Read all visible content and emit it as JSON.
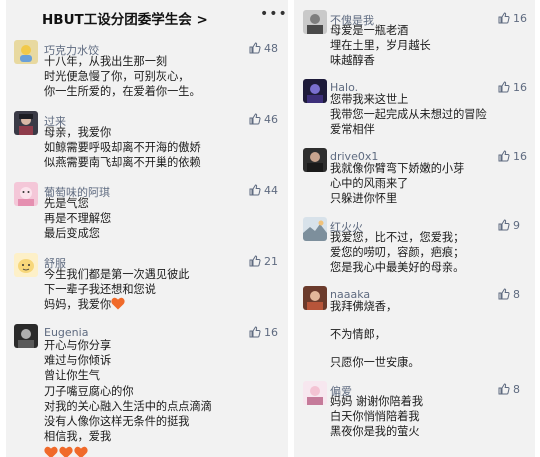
{
  "header": {
    "title": "HBUT工设分团委学生会 >"
  },
  "left": [
    {
      "nick": "巧克力水饺",
      "likes": "48",
      "lines": [
        "十八年，从我出生那一刻",
        "时光便急慢了你，可别灰心，",
        "你一生所爱的，在爱着你一生。"
      ]
    },
    {
      "nick": "过来",
      "likes": "46",
      "lines": [
        "母亲，我爱你",
        "如鲸需要呼吸却离不开海的傲娇",
        "似燕需要南飞却离不开巢的依赖"
      ]
    },
    {
      "nick": "葡萄味的阿琪",
      "likes": "44",
      "lines": [
        "先是气您",
        "再是不理解您",
        "最后变成您"
      ]
    },
    {
      "nick": "舒服",
      "likes": "21",
      "lines": [
        "今生我们都是第一次遇见彼此",
        "下一辈子我还想和您说",
        "妈妈，我爱你"
      ]
    },
    {
      "nick": "Eugenia",
      "likes": "16",
      "lines": [
        "开心与你分享",
        "难过与你倾诉",
        "曾让你生气",
        "刀子嘴豆腐心的你",
        "对我的关心融入生活中的点点滴滴",
        "没有人像你这样无条件的挺我",
        "相信我，爱我"
      ]
    }
  ],
  "right": [
    {
      "nick": "不傀是我",
      "likes": "16",
      "lines": [
        "母爱是一瓶老酒",
        "埋在土里，岁月越长",
        "味越醇香"
      ]
    },
    {
      "nick": "Halo.",
      "likes": "16",
      "lines": [
        "您带我来这世上",
        "我带您一起完成从未想过的冒险",
        "爱常相伴"
      ]
    },
    {
      "nick": "drive0x1",
      "likes": "16",
      "lines": [
        "我就像你臂弯下娇嫩的小芽",
        "心中的风雨来了",
        "只躲进你怀里"
      ]
    },
    {
      "nick": "红火火",
      "likes": "9",
      "lines": [
        "我爱您，比不过，您爱我；",
        "爱您的唠叨，容颜，疤痕；",
        "您是我心中最美好的母亲。"
      ]
    },
    {
      "nick": "naaaka",
      "likes": "8",
      "lines": [
        "我拜佛烧香，",
        "",
        "不为情郎，",
        "",
        "只愿你一世安康。"
      ]
    },
    {
      "nick": "偏爱",
      "likes": "8",
      "lines": [
        "妈妈 谢谢你陪着我",
        "白天你悄悄陪着我",
        "黑夜你是我的萤火"
      ]
    }
  ],
  "colors": {
    "heart": "#f06a2a",
    "meta": "#5f6b80",
    "panel_bg": "#f2f2f2"
  },
  "icons": {
    "like": "thumbs-up-icon",
    "more": "more-dots-icon",
    "heart": "heart-icon"
  }
}
